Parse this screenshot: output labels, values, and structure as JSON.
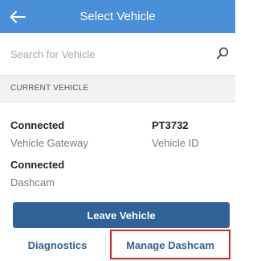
{
  "header": {
    "title": "Select Vehicle",
    "back_icon": "arrow-left-icon",
    "background_color": "#4a90d9"
  },
  "search": {
    "placeholder": "Search for Vehicle",
    "value": "",
    "icon": "search-icon"
  },
  "current_vehicle": {
    "section_label": "CURRENT VEHICLE",
    "gateway_status": "Connected",
    "gateway_label": "Vehicle Gateway",
    "vehicle_id": "PT3732",
    "vehicle_id_label": "Vehicle ID",
    "dashcam_status": "Connected",
    "dashcam_label": "Dashcam"
  },
  "actions": {
    "leave_label": "Leave Vehicle",
    "diagnostics_label": "Diagnostics",
    "manage_dashcam_label": "Manage Dashcam",
    "primary_color": "#2f6397",
    "highlight_color": "#e02020"
  }
}
